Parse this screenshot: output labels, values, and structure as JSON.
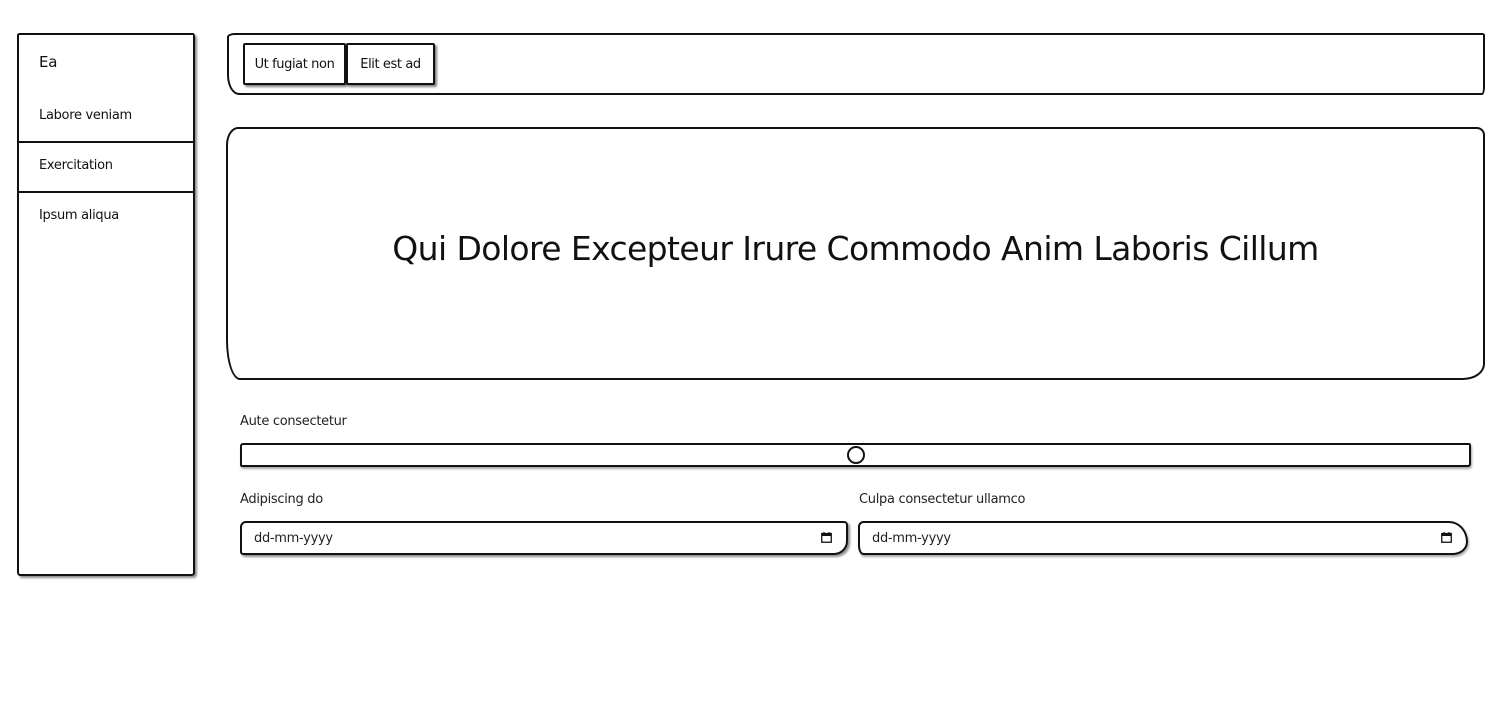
{
  "sidebar": {
    "brand": "Ea",
    "items": [
      {
        "label": "Labore veniam"
      },
      {
        "label": "Exercitation"
      },
      {
        "label": "Ipsum aliqua"
      }
    ]
  },
  "topbar": {
    "tabs": [
      {
        "label": "Ut fugiat non"
      },
      {
        "label": "Elit est ad"
      }
    ]
  },
  "hero": {
    "title": "Qui Dolore Excepteur Irure Commodo Anim Laboris Cillum"
  },
  "form": {
    "slider": {
      "label": "Aute consectetur",
      "value_fraction": 0.5
    },
    "date_left": {
      "label": "Adipiscing do",
      "placeholder": "dd-mm-yyyy",
      "icon": "calendar-icon"
    },
    "date_right": {
      "label": "Culpa consectetur ullamco",
      "placeholder": "dd-mm-yyyy",
      "icon": "calendar-icon"
    }
  }
}
